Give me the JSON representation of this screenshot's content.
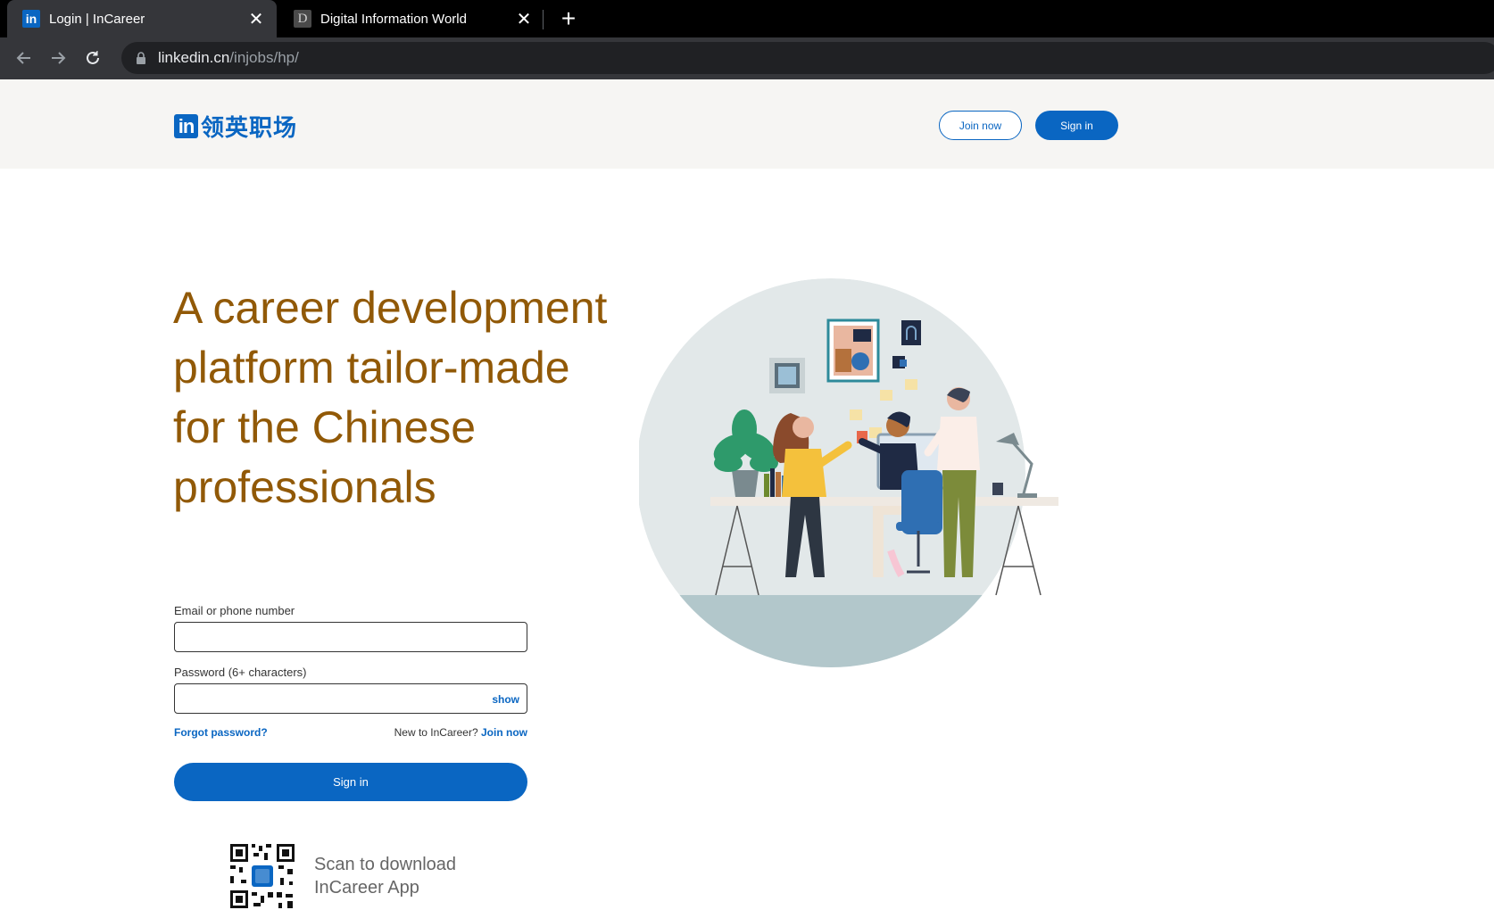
{
  "browser": {
    "tabs": [
      {
        "title": "Login | InCareer",
        "favicon": "linkedin-icon",
        "active": true
      },
      {
        "title": "Digital Information World",
        "favicon": "d-letter-icon",
        "active": false
      }
    ],
    "url_host": "linkedin.cn",
    "url_path": "/injobs/hp/"
  },
  "header": {
    "logo_in": "in",
    "logo_text": "领英职场",
    "join_label": "Join now",
    "signin_label": "Sign in"
  },
  "hero": {
    "headline": "A career development platform tailor-made for the Chinese professionals"
  },
  "form": {
    "email_label": "Email or phone number",
    "email_value": "",
    "password_label": "Password (6+ characters)",
    "password_value": "",
    "show_label": "show",
    "forgot_label": "Forgot password?",
    "new_prefix": "New to InCareer?",
    "join_link": "Join now",
    "submit_label": "Sign in"
  },
  "app": {
    "scan_line1": "Scan to download",
    "scan_line2": "InCareer App"
  },
  "colors": {
    "brand_blue": "#0a66c2",
    "headline_brown": "#915907",
    "header_bg": "#f6f5f3"
  }
}
